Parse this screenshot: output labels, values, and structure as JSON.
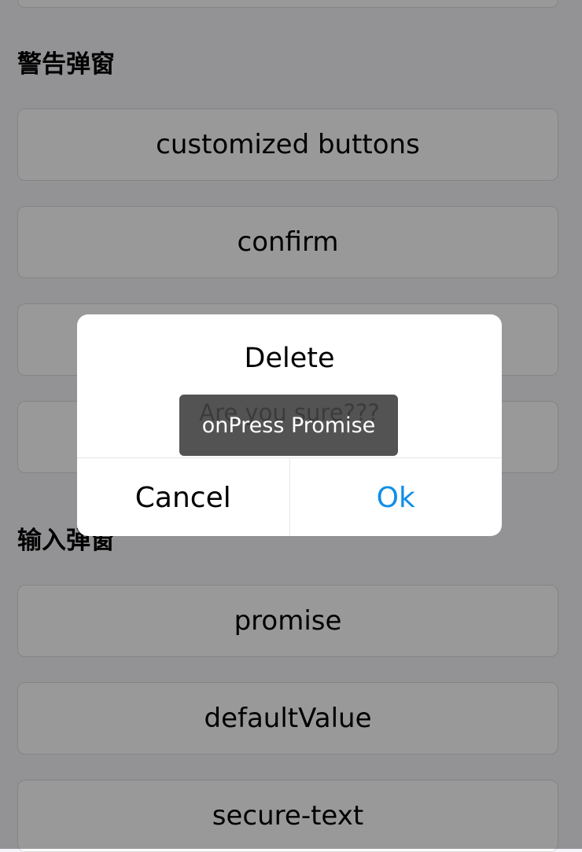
{
  "sections": {
    "alert_title": "警告弹窗",
    "prompt_title": "输入弹窗"
  },
  "buttons": {
    "customized": "customized buttons",
    "confirm": "confirm",
    "promise": "promise",
    "default_value": "defaultValue",
    "secure_text": "secure-text"
  },
  "modal": {
    "title": "Delete",
    "message": "Are you sure???",
    "cancel_label": "Cancel",
    "ok_label": "Ok"
  },
  "toast": {
    "text": "onPress Promise"
  },
  "colors": {
    "ok_accent": "#108ee9",
    "overlay": "rgba(0,0,0,0.4)"
  }
}
